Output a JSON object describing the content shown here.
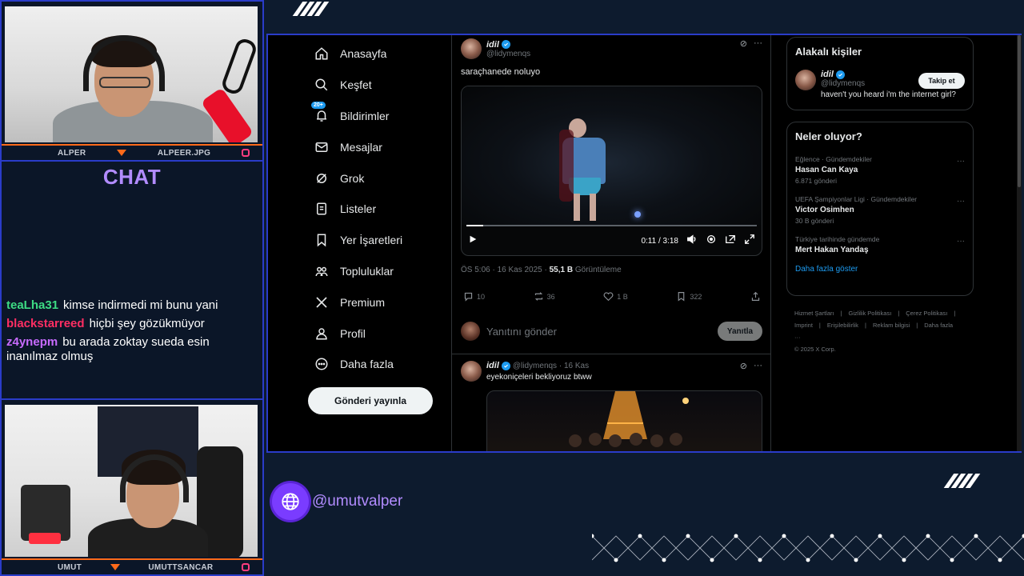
{
  "overlay": {
    "top_cam": {
      "name": "ALPER",
      "handle": "ALPEER.JPG"
    },
    "bottom_cam": {
      "name": "UMUT",
      "handle": "UMUTTSANCAR"
    },
    "chat_title": "CHAT",
    "chat_messages": [
      {
        "user": "teaLha31",
        "color": "#3ddc84",
        "text": "kimse indirmedi mi bunu yani"
      },
      {
        "user": "blackstarreed",
        "color": "#ff2e63",
        "text": "hiçbi şey gözükmüyor"
      },
      {
        "user": "z4ynepm",
        "color": "#c86bff",
        "text": "bu arada zoktay sueda esin inanılmaz olmuş"
      }
    ],
    "handle_text": "@umutvalper",
    "accent": "#2a3cc9",
    "brand": "#7a3cff"
  },
  "x": {
    "nav": [
      {
        "label": "Anasayfa",
        "icon": "home-icon"
      },
      {
        "label": "Keşfet",
        "icon": "search-icon"
      },
      {
        "label": "Bildirimler",
        "icon": "bell-icon",
        "badge": "20+"
      },
      {
        "label": "Mesajlar",
        "icon": "envelope-icon"
      },
      {
        "label": "Grok",
        "icon": "grok-icon"
      },
      {
        "label": "Listeler",
        "icon": "list-icon"
      },
      {
        "label": "Yer İşaretleri",
        "icon": "bookmark-icon"
      },
      {
        "label": "Topluluklar",
        "icon": "people-icon"
      },
      {
        "label": "Premium",
        "icon": "x-logo-icon"
      },
      {
        "label": "Profil",
        "icon": "person-icon"
      },
      {
        "label": "Daha fazla",
        "icon": "more-circle-icon"
      }
    ],
    "post_button": "Gönderi yayınla",
    "tweet": {
      "name": "idil",
      "handle": "@lidymenqs",
      "text": "saraçhanede noluyo",
      "video_time": "0:11 / 3:18",
      "progress": 0.058,
      "timestamp": "ÖS 5:06 · 16 Kas 2025 · ",
      "views": "55,1 B",
      "views_label": " Görüntüleme",
      "replies": "10",
      "reposts": "36",
      "likes": "1 B",
      "bookmarks": "322",
      "reply_placeholder": "Yanıtını gönder",
      "reply_button": "Yanıtla"
    },
    "tweet2": {
      "name": "idil",
      "handle_date": "@lidymenqs · 16 Kas",
      "text": "eyekoniçeleri bekliyoruz btww"
    },
    "related": {
      "title": "Alakalı kişiler",
      "name": "idil",
      "handle": "@lidymenqs",
      "bio": "haven't you heard i'm the internet girl?",
      "follow_label": "Takip et"
    },
    "trends": {
      "title": "Neler oluyor?",
      "items": [
        {
          "category": "Eğlence · Gündemdekiler",
          "name": "Hasan Can Kaya",
          "count": "6.871 gönderi"
        },
        {
          "category": "UEFA Şampiyonlar Ligi · Gündemdekiler",
          "name": "Victor Osimhen",
          "count": "30 B gönderi"
        },
        {
          "category": "Türkiye tarihinde gündemde",
          "name": "Mert Hakan Yandaş",
          "count": ""
        }
      ],
      "show_more": "Daha fazla göster"
    },
    "footer": [
      "Hizmet Şartları",
      "|",
      "Gizlilik Politikası",
      "|",
      "Çerez Politikası",
      "|",
      "Imprint",
      "|",
      "Erişilebilirlik",
      "|",
      "Reklam bilgisi",
      "|",
      "Daha fazla ···",
      "© 2025 X Corp."
    ]
  }
}
